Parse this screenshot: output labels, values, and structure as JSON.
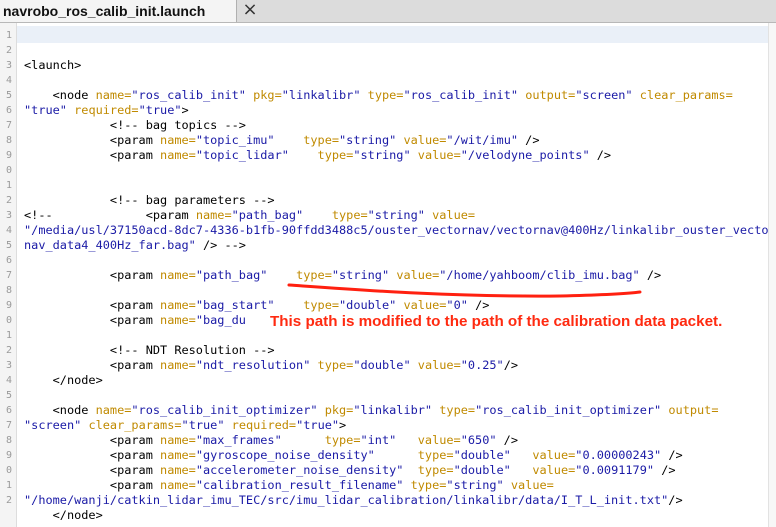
{
  "editor": {
    "tab_title": "navrobo_ros_calib_init.launch",
    "tab_close": "×"
  },
  "lines": [
    [],
    [],
    [
      [
        "t",
        "<launch>"
      ]
    ],
    [],
    [
      [
        "t",
        "    <node "
      ],
      [
        "a",
        "name="
      ],
      [
        "v",
        "\"ros_calib_init\""
      ],
      [
        "t",
        " "
      ],
      [
        "a",
        "pkg="
      ],
      [
        "v",
        "\"linkalibr\""
      ],
      [
        "t",
        " "
      ],
      [
        "a",
        "type="
      ],
      [
        "v",
        "\"ros_calib_init\""
      ],
      [
        "t",
        " "
      ],
      [
        "a",
        "output="
      ],
      [
        "v",
        "\"screen\""
      ],
      [
        "t",
        " "
      ],
      [
        "a",
        "clear_params="
      ]
    ],
    [
      [
        "v",
        "\"true\""
      ],
      [
        "t",
        " "
      ],
      [
        "a",
        "required="
      ],
      [
        "v",
        "\"true\""
      ],
      [
        "t",
        ">"
      ]
    ],
    [
      [
        "c",
        "            <!-- bag topics -->"
      ]
    ],
    [
      [
        "t",
        "            <param "
      ],
      [
        "a",
        "name="
      ],
      [
        "v",
        "\"topic_imu\""
      ],
      [
        "t",
        "    "
      ],
      [
        "a",
        "type="
      ],
      [
        "v",
        "\"string\""
      ],
      [
        "t",
        " "
      ],
      [
        "a",
        "value="
      ],
      [
        "v",
        "\"/wit/imu\""
      ],
      [
        "t",
        " />"
      ]
    ],
    [
      [
        "t",
        "            <param "
      ],
      [
        "a",
        "name="
      ],
      [
        "v",
        "\"topic_lidar\""
      ],
      [
        "t",
        "    "
      ],
      [
        "a",
        "type="
      ],
      [
        "v",
        "\"string\""
      ],
      [
        "t",
        " "
      ],
      [
        "a",
        "value="
      ],
      [
        "v",
        "\"/velodyne_points\""
      ],
      [
        "t",
        " />"
      ]
    ],
    [],
    [],
    [
      [
        "c",
        "            <!-- bag parameters -->"
      ]
    ],
    [
      [
        "c",
        "<!--             <param "
      ],
      [
        "a",
        "name="
      ],
      [
        "v",
        "\"path_bag\""
      ],
      [
        "t",
        "    "
      ],
      [
        "a",
        "type="
      ],
      [
        "v",
        "\"string\""
      ],
      [
        "t",
        " "
      ],
      [
        "a",
        "value="
      ]
    ],
    [
      [
        "v",
        "\"/media/usl/37150acd-8dc7-4336-b1fb-90ffdd3488c5/ouster_vectornav/vectornav@400Hz/linkalibr_ouster_vecto"
      ]
    ],
    [
      [
        "v",
        "nav_data4_400Hz_far.bag\""
      ],
      [
        "t",
        " /> -->"
      ]
    ],
    [],
    [
      [
        "t",
        "            <param "
      ],
      [
        "a",
        "name="
      ],
      [
        "v",
        "\"path_bag\""
      ],
      [
        "t",
        "    "
      ],
      [
        "a",
        "type="
      ],
      [
        "v",
        "\"string\""
      ],
      [
        "t",
        " "
      ],
      [
        "a",
        "value="
      ],
      [
        "v",
        "\"/home/yahboom/clib_imu.bag\""
      ],
      [
        "t",
        " />"
      ]
    ],
    [],
    [
      [
        "t",
        "            <param "
      ],
      [
        "a",
        "name="
      ],
      [
        "v",
        "\"bag_start\""
      ],
      [
        "t",
        "    "
      ],
      [
        "a",
        "type="
      ],
      [
        "v",
        "\"double\""
      ],
      [
        "t",
        " "
      ],
      [
        "a",
        "value="
      ],
      [
        "v",
        "\"0\""
      ],
      [
        "t",
        " />"
      ]
    ],
    [
      [
        "t",
        "            <param "
      ],
      [
        "a",
        "name="
      ],
      [
        "v",
        "\"bag_du"
      ]
    ],
    [],
    [
      [
        "c",
        "            <!-- NDT Resolution -->"
      ]
    ],
    [
      [
        "t",
        "            <param "
      ],
      [
        "a",
        "name="
      ],
      [
        "v",
        "\"ndt_resolution\""
      ],
      [
        "t",
        " "
      ],
      [
        "a",
        "type="
      ],
      [
        "v",
        "\"double\""
      ],
      [
        "t",
        " "
      ],
      [
        "a",
        "value="
      ],
      [
        "v",
        "\"0.25\""
      ],
      [
        "t",
        "/>"
      ]
    ],
    [
      [
        "t",
        "    </node>"
      ]
    ],
    [],
    [
      [
        "t",
        "    <node "
      ],
      [
        "a",
        "name="
      ],
      [
        "v",
        "\"ros_calib_init_optimizer\""
      ],
      [
        "t",
        " "
      ],
      [
        "a",
        "pkg="
      ],
      [
        "v",
        "\"linkalibr\""
      ],
      [
        "t",
        " "
      ],
      [
        "a",
        "type="
      ],
      [
        "v",
        "\"ros_calib_init_optimizer\""
      ],
      [
        "t",
        " "
      ],
      [
        "a",
        "output="
      ]
    ],
    [
      [
        "v",
        "\"screen\""
      ],
      [
        "t",
        " "
      ],
      [
        "a",
        "clear_params="
      ],
      [
        "v",
        "\"true\""
      ],
      [
        "t",
        " "
      ],
      [
        "a",
        "required="
      ],
      [
        "v",
        "\"true\""
      ],
      [
        "t",
        ">"
      ]
    ],
    [
      [
        "t",
        "            <param "
      ],
      [
        "a",
        "name="
      ],
      [
        "v",
        "\"max_frames\""
      ],
      [
        "t",
        "      "
      ],
      [
        "a",
        "type="
      ],
      [
        "v",
        "\"int\""
      ],
      [
        "t",
        "   "
      ],
      [
        "a",
        "value="
      ],
      [
        "v",
        "\"650\""
      ],
      [
        "t",
        " />"
      ]
    ],
    [
      [
        "t",
        "            <param "
      ],
      [
        "a",
        "name="
      ],
      [
        "v",
        "\"gyroscope_noise_density\""
      ],
      [
        "t",
        "      "
      ],
      [
        "a",
        "type="
      ],
      [
        "v",
        "\"double\""
      ],
      [
        "t",
        "   "
      ],
      [
        "a",
        "value="
      ],
      [
        "v",
        "\"0.00000243\""
      ],
      [
        "t",
        " />"
      ]
    ],
    [
      [
        "t",
        "            <param "
      ],
      [
        "a",
        "name="
      ],
      [
        "v",
        "\"accelerometer_noise_density\""
      ],
      [
        "t",
        "  "
      ],
      [
        "a",
        "type="
      ],
      [
        "v",
        "\"double\""
      ],
      [
        "t",
        "   "
      ],
      [
        "a",
        "value="
      ],
      [
        "v",
        "\"0.0091179\""
      ],
      [
        "t",
        " />"
      ]
    ],
    [
      [
        "t",
        "            <param "
      ],
      [
        "a",
        "name="
      ],
      [
        "v",
        "\"calibration_result_filename\""
      ],
      [
        "t",
        " "
      ],
      [
        "a",
        "type="
      ],
      [
        "v",
        "\"string\""
      ],
      [
        "t",
        " "
      ],
      [
        "a",
        "value="
      ]
    ],
    [
      [
        "v",
        "\"/home/wanji/catkin_lidar_imu_TEC/src/imu_lidar_calibration/linkalibr/data/I_T_L_init.txt\""
      ],
      [
        "t",
        "/>"
      ]
    ],
    [
      [
        "t",
        "    </node>"
      ]
    ]
  ],
  "line_numbers": [
    "1",
    "2",
    "3",
    "4",
    "5",
    "6",
    "7",
    "8",
    "9",
    "0",
    "1",
    "2",
    "3",
    "4",
    "5",
    "6",
    "7",
    "8",
    "9",
    "0",
    "1",
    "2",
    "3",
    "4",
    "5",
    "6",
    "7",
    "8",
    "9",
    "0",
    "1",
    "2"
  ],
  "annotation": {
    "text": "This path is modified to the path of the calibration data packet.",
    "color": "#ff2a10"
  },
  "syntax_colors": {
    "tag": "#000000",
    "attribute": "#c08a00",
    "value": "#1a1aa6",
    "comment": "#000000"
  }
}
